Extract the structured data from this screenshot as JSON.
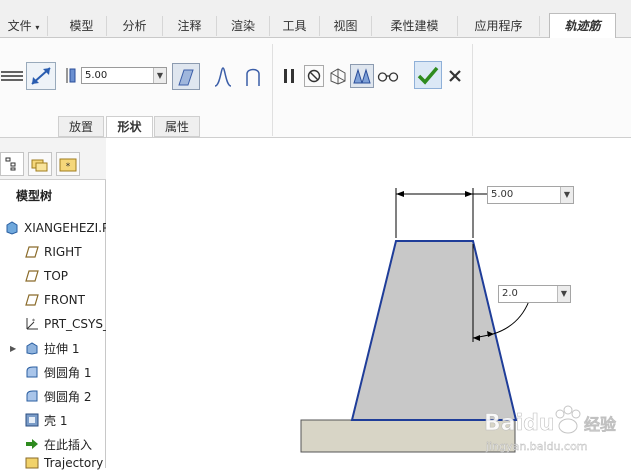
{
  "menu": {
    "file": "文件",
    "tabs": [
      "模型",
      "分析",
      "注释",
      "渲染",
      "工具",
      "视图",
      "柔性建模",
      "应用程序"
    ],
    "active_tab": "轨迹筋"
  },
  "toolbar": {
    "depth_value": "5.00",
    "subtabs": [
      "放置",
      "形状",
      "属性"
    ]
  },
  "panel": {
    "title": "模型树",
    "items": [
      {
        "label": "XIANGEHEZI.P"
      },
      {
        "label": "RIGHT"
      },
      {
        "label": "TOP"
      },
      {
        "label": "FRONT"
      },
      {
        "label": "PRT_CSYS_"
      },
      {
        "label": "拉伸 1"
      },
      {
        "label": "倒圆角 1"
      },
      {
        "label": "倒圆角 2"
      },
      {
        "label": "壳 1"
      },
      {
        "label": "在此插入"
      },
      {
        "label": "Trajectory"
      }
    ]
  },
  "canvas": {
    "width_dim": "5.00",
    "angle_dim": "2.0"
  },
  "watermark": {
    "brand": "Baidu",
    "brand_cn": "经验",
    "url": "jingyan.baidu.com"
  },
  "colors": {
    "outline": "#1f3d99",
    "fill": "#c8c8c8",
    "base": "#d8d5c6",
    "check": "#2e8b1e"
  }
}
